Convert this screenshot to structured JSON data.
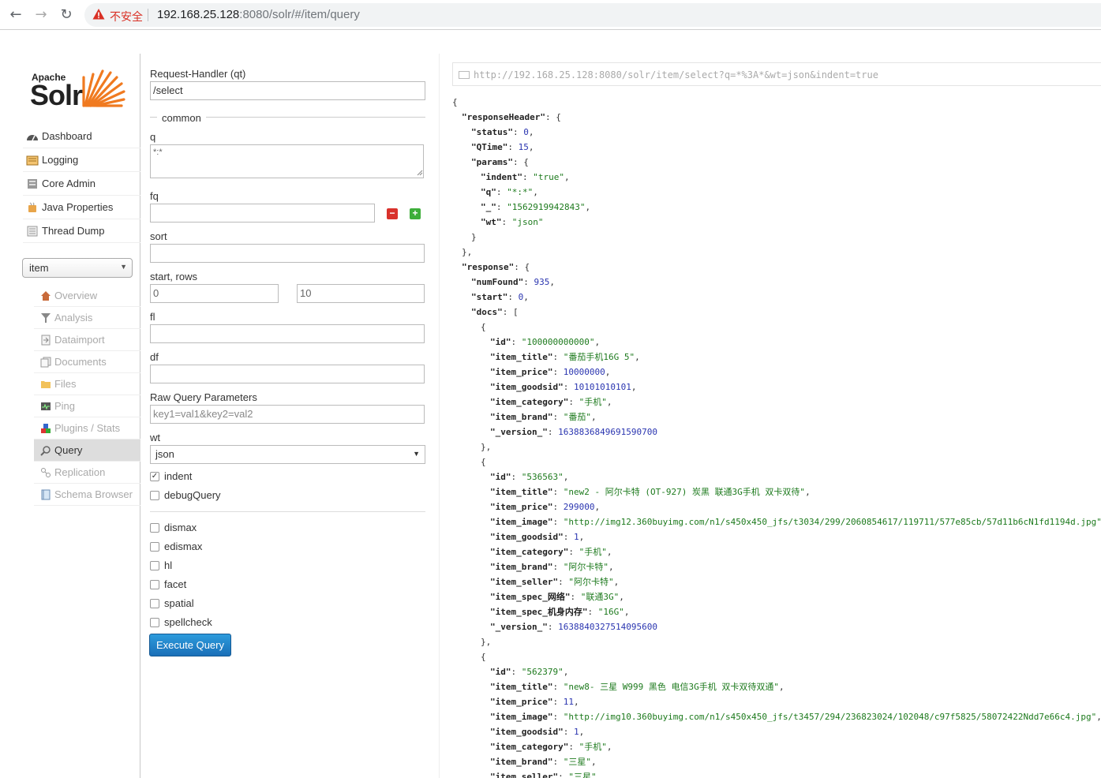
{
  "browser": {
    "back": "←",
    "forward": "→",
    "reload": "↻",
    "security_label": "不安全",
    "url_host": "192.168.25.128",
    "url_rest": ":8080/solr/#/item/query"
  },
  "logo": {
    "apache": "Apache",
    "solr": "Solr"
  },
  "menu": [
    {
      "label": "Dashboard",
      "icon": "dashboard-icon"
    },
    {
      "label": "Logging",
      "icon": "logging-icon"
    },
    {
      "label": "Core Admin",
      "icon": "core-admin-icon"
    },
    {
      "label": "Java Properties",
      "icon": "java-properties-icon"
    },
    {
      "label": "Thread Dump",
      "icon": "thread-dump-icon"
    }
  ],
  "core_selector": {
    "value": "item",
    "arrow": "▼"
  },
  "core_menu": [
    {
      "label": "Overview",
      "icon": "home-icon"
    },
    {
      "label": "Analysis",
      "icon": "funnel-icon"
    },
    {
      "label": "Dataimport",
      "icon": "dataimport-icon"
    },
    {
      "label": "Documents",
      "icon": "documents-icon"
    },
    {
      "label": "Files",
      "icon": "folder-icon"
    },
    {
      "label": "Ping",
      "icon": "ping-icon"
    },
    {
      "label": "Plugins / Stats",
      "icon": "plugins-icon"
    },
    {
      "label": "Query",
      "icon": "magnifier-icon"
    },
    {
      "label": "Replication",
      "icon": "replication-icon"
    },
    {
      "label": "Schema Browser",
      "icon": "book-icon"
    }
  ],
  "form": {
    "request_handler_label": "Request-Handler (qt)",
    "request_handler_value": "/select",
    "common_label": "common",
    "q_label": "q",
    "q_value": "*:*",
    "fq_label": "fq",
    "fq_value": "",
    "remove_btn": "−",
    "add_btn": "+",
    "sort_label": "sort",
    "sort_value": "",
    "start_rows_label": "start, rows",
    "start_value": "0",
    "rows_value": "10",
    "fl_label": "fl",
    "fl_value": "",
    "df_label": "df",
    "df_value": "",
    "raw_label": "Raw Query Parameters",
    "raw_placeholder": "key1=val1&key2=val2",
    "wt_label": "wt",
    "wt_value": "json",
    "wt_arrow": "▼",
    "checkboxes": [
      {
        "label": "indent",
        "checked": true,
        "mark": "✓"
      },
      {
        "label": "debugQuery",
        "checked": false,
        "mark": ""
      }
    ],
    "options": [
      {
        "label": "dismax",
        "checked": false
      },
      {
        "label": "edismax",
        "checked": false
      },
      {
        "label": "hl",
        "checked": false
      },
      {
        "label": "facet",
        "checked": false
      },
      {
        "label": "spatial",
        "checked": false
      },
      {
        "label": "spellcheck",
        "checked": false
      }
    ],
    "execute_label": "Execute Query"
  },
  "response": {
    "url": "http://192.168.25.128:8080/solr/item/select?q=*%3A*&wt=json&indent=true",
    "lines": [
      {
        "indent": 0,
        "text": "{"
      },
      {
        "indent": 1,
        "key": "responseHeader",
        "text": ": {"
      },
      {
        "indent": 2,
        "key": "status",
        "num": "0",
        "text": ","
      },
      {
        "indent": 2,
        "key": "QTime",
        "num": "15",
        "text": ","
      },
      {
        "indent": 2,
        "key": "params",
        "text": ": {"
      },
      {
        "indent": 3,
        "key": "indent",
        "str": "\"true\"",
        "text": ","
      },
      {
        "indent": 3,
        "key": "q",
        "str": "\"*:*\"",
        "text": ","
      },
      {
        "indent": 3,
        "key": "_",
        "str": "\"1562919942843\"",
        "text": ","
      },
      {
        "indent": 3,
        "key": "wt",
        "str": "\"json\"",
        "text": ""
      },
      {
        "indent": 2,
        "text": "}"
      },
      {
        "indent": 1,
        "text": "},"
      },
      {
        "indent": 1,
        "key": "response",
        "text": ": {"
      },
      {
        "indent": 2,
        "key": "numFound",
        "num": "935",
        "text": ","
      },
      {
        "indent": 2,
        "key": "start",
        "num": "0",
        "text": ","
      },
      {
        "indent": 2,
        "key": "docs",
        "text": ": ["
      },
      {
        "indent": 3,
        "text": "{"
      },
      {
        "indent": 4,
        "key": "id",
        "str": "\"100000000000\"",
        "text": ","
      },
      {
        "indent": 4,
        "key": "item_title",
        "str": "\"番茄手机16G 5\"",
        "text": ","
      },
      {
        "indent": 4,
        "key": "item_price",
        "num": "10000000",
        "text": ","
      },
      {
        "indent": 4,
        "key": "item_goodsid",
        "num": "10101010101",
        "text": ","
      },
      {
        "indent": 4,
        "key": "item_category",
        "str": "\"手机\"",
        "text": ","
      },
      {
        "indent": 4,
        "key": "item_brand",
        "str": "\"番茄\"",
        "text": ","
      },
      {
        "indent": 4,
        "key": "_version_",
        "num": "1638836849691590700",
        "text": ""
      },
      {
        "indent": 3,
        "text": "},"
      },
      {
        "indent": 3,
        "text": "{"
      },
      {
        "indent": 4,
        "key": "id",
        "str": "\"536563\"",
        "text": ","
      },
      {
        "indent": 4,
        "key": "item_title",
        "str": "\"new2 - 阿尔卡特 (OT-927) 炭黑 联通3G手机 双卡双待\"",
        "text": ","
      },
      {
        "indent": 4,
        "key": "item_price",
        "num": "299000",
        "text": ","
      },
      {
        "indent": 4,
        "key": "item_image",
        "str": "\"http://img12.360buyimg.com/n1/s450x450_jfs/t3034/299/2060854617/119711/577e85cb/57d11b6cN1fd1194d.jpg\"",
        "text": ","
      },
      {
        "indent": 4,
        "key": "item_goodsid",
        "num": "1",
        "text": ","
      },
      {
        "indent": 4,
        "key": "item_category",
        "str": "\"手机\"",
        "text": ","
      },
      {
        "indent": 4,
        "key": "item_brand",
        "str": "\"阿尔卡特\"",
        "text": ","
      },
      {
        "indent": 4,
        "key": "item_seller",
        "str": "\"阿尔卡特\"",
        "text": ","
      },
      {
        "indent": 4,
        "key": "item_spec_网络",
        "str": "\"联通3G\"",
        "text": ","
      },
      {
        "indent": 4,
        "key": "item_spec_机身内存",
        "str": "\"16G\"",
        "text": ","
      },
      {
        "indent": 4,
        "key": "_version_",
        "num": "1638840327514095600",
        "text": ""
      },
      {
        "indent": 3,
        "text": "},"
      },
      {
        "indent": 3,
        "text": "{"
      },
      {
        "indent": 4,
        "key": "id",
        "str": "\"562379\"",
        "text": ","
      },
      {
        "indent": 4,
        "key": "item_title",
        "str": "\"new8- 三星 W999 黑色 电信3G手机 双卡双待双通\"",
        "text": ","
      },
      {
        "indent": 4,
        "key": "item_price",
        "num": "11",
        "text": ","
      },
      {
        "indent": 4,
        "key": "item_image",
        "str": "\"http://img10.360buyimg.com/n1/s450x450_jfs/t3457/294/236823024/102048/c97f5825/58072422Ndd7e66c4.jpg\"",
        "text": ","
      },
      {
        "indent": 4,
        "key": "item_goodsid",
        "num": "1",
        "text": ","
      },
      {
        "indent": 4,
        "key": "item_category",
        "str": "\"手机\"",
        "text": ","
      },
      {
        "indent": 4,
        "key": "item_brand",
        "str": "\"三星\"",
        "text": ","
      },
      {
        "indent": 4,
        "key": "item_seller",
        "str": "\"三星\"",
        "text": ","
      }
    ]
  }
}
